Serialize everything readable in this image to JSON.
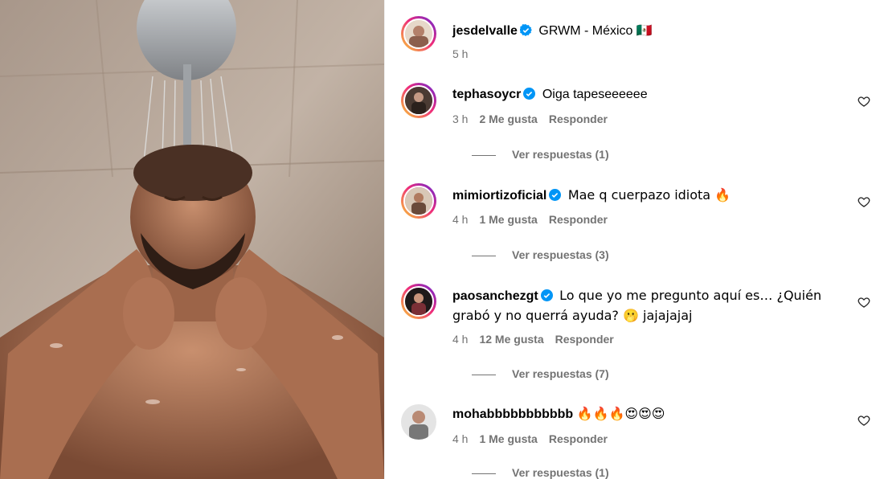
{
  "post": {
    "author": "jesdelvalle",
    "caption": "GRWM - México 🇲🇽",
    "time": "5 h"
  },
  "comments": [
    {
      "user": "tephasoycr",
      "verified": true,
      "text": "Oiga tapeseeeeee",
      "time": "3 h",
      "likes": "2 Me gusta",
      "reply": "Responder",
      "replies": "Ver respuestas (1)"
    },
    {
      "user": "mimiortizoficial",
      "verified": true,
      "text": "Mae q cuerpazo idiota 🔥",
      "time": "4 h",
      "likes": "1 Me gusta",
      "reply": "Responder",
      "replies": "Ver respuestas (3)"
    },
    {
      "user": "paosanchezgt",
      "verified": true,
      "text": "Lo que yo me pregunto aquí es… ¿Quién grabó y no querrá ayuda? 🫢 jajajajaj",
      "time": "4 h",
      "likes": "12 Me gusta",
      "reply": "Responder",
      "replies": "Ver respuestas (7)"
    },
    {
      "user": "mohabbbbbbbbbbb",
      "verified": false,
      "text": "🔥🔥🔥😍😍😍",
      "time": "4 h",
      "likes": "1 Me gusta",
      "reply": "Responder",
      "replies": "Ver respuestas (1)"
    }
  ],
  "colors": {
    "verified": "#0095f6",
    "secondary_text": "#737373",
    "story_ring": [
      "#f9ce34",
      "#ee2a7b",
      "#6228d7"
    ]
  },
  "icons": {
    "verified": "verified-badge-icon",
    "like": "heart-outline-icon"
  }
}
